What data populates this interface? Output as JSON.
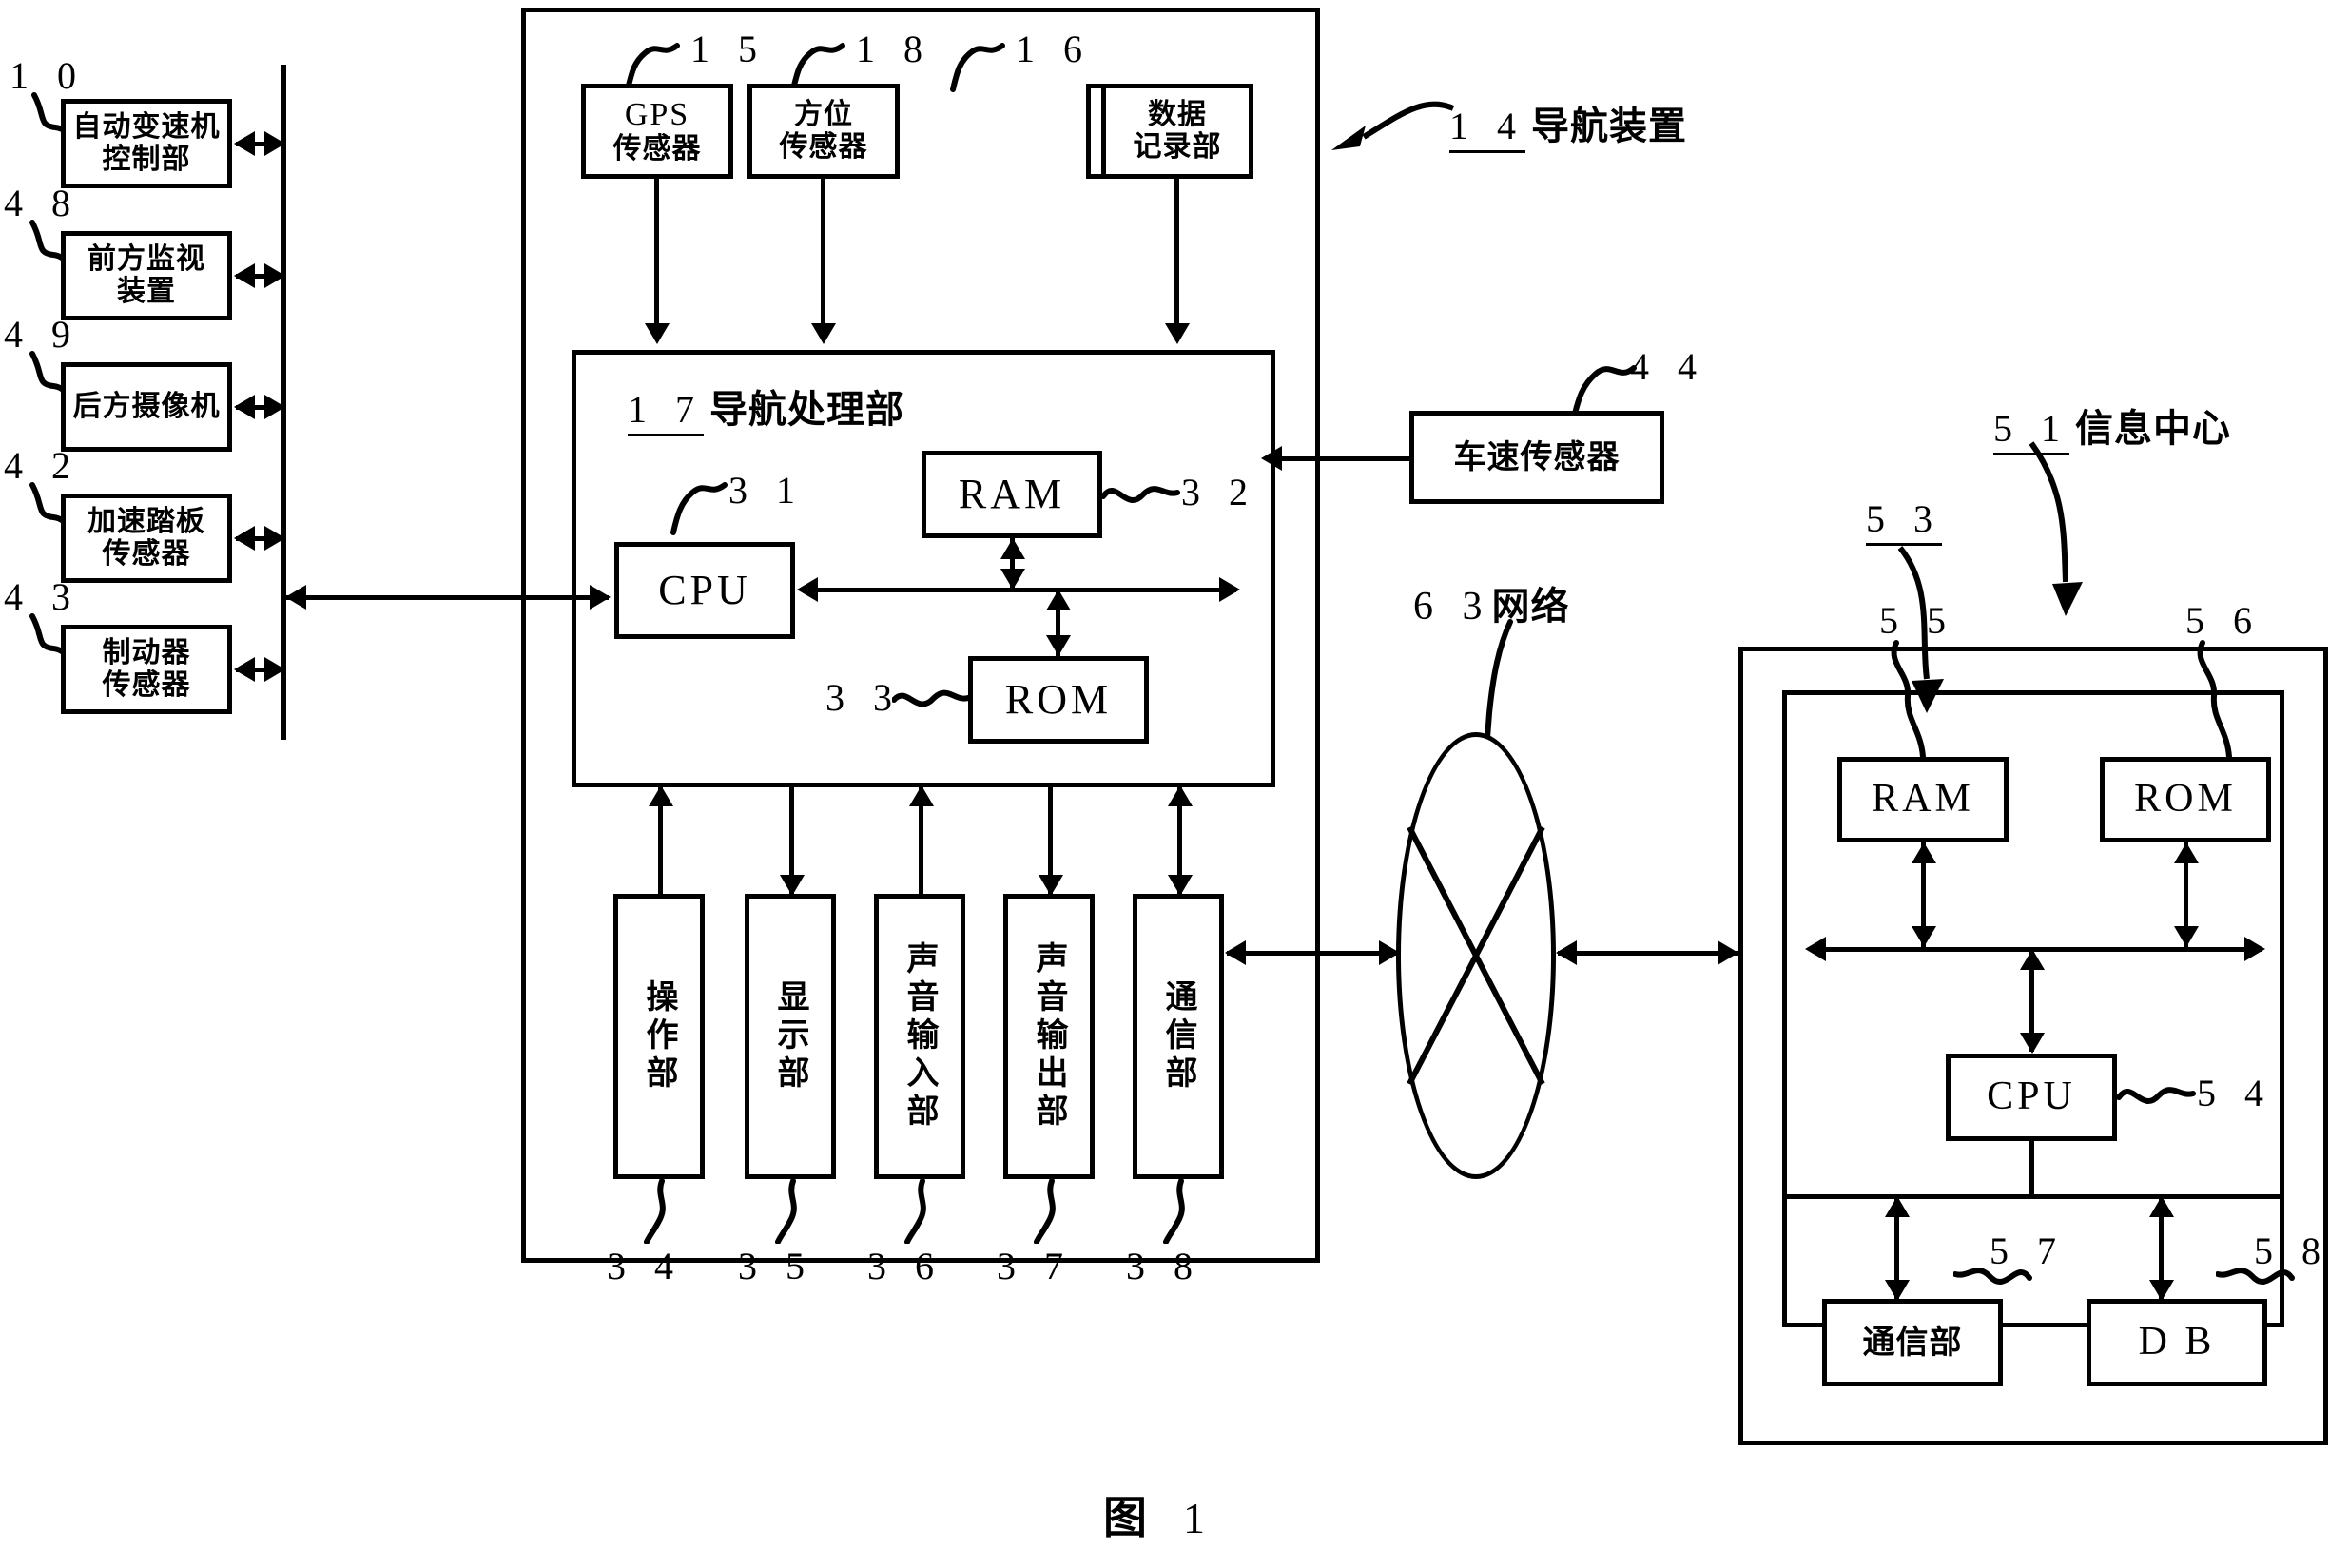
{
  "figure": {
    "caption_label": "图",
    "caption_number": "1"
  },
  "vehicle_units": [
    {
      "ref": "1 0",
      "label_line1": "自动变速机",
      "label_line2": "控制部"
    },
    {
      "ref": "4 8",
      "label_line1": "前方监视",
      "label_line2": "装置"
    },
    {
      "ref": "4 9",
      "label_line1": "后方摄像机",
      "label_line2": ""
    },
    {
      "ref": "4 2",
      "label_line1": "加速踏板",
      "label_line2": "传感器"
    },
    {
      "ref": "4 3",
      "label_line1": "制动器",
      "label_line2": "传感器"
    }
  ],
  "navigation": {
    "ref": "1 4",
    "title": "导航装置",
    "sensors": [
      {
        "ref": "1 5",
        "line1": "GPS",
        "line2": "传感器"
      },
      {
        "ref": "1 8",
        "line1": "方位",
        "line2": "传感器"
      },
      {
        "ref": "1 6",
        "line1": "数据",
        "line2": "记录部"
      }
    ],
    "processor": {
      "ref": "1 7",
      "title": "导航处理部",
      "cpu": {
        "ref": "3 1",
        "label": "CPU"
      },
      "ram": {
        "ref": "3 2",
        "label": "RAM"
      },
      "rom": {
        "ref": "3 3",
        "label": "ROM"
      }
    },
    "io_units": [
      {
        "ref": "3 4",
        "label": "操作部"
      },
      {
        "ref": "3 5",
        "label": "显示部"
      },
      {
        "ref": "3 6",
        "label": "声音输入部"
      },
      {
        "ref": "3 7",
        "label": "声音输出部"
      },
      {
        "ref": "3 8",
        "label": "通信部"
      }
    ]
  },
  "speed_sensor": {
    "ref": "4 4",
    "label": "车速传感器"
  },
  "network": {
    "ref": "6 3",
    "label": "网络"
  },
  "info_center": {
    "ref": "5 1",
    "title": "信息中心",
    "inner_ref": "5 3",
    "ram": {
      "ref": "5 5",
      "label": "RAM"
    },
    "rom": {
      "ref": "5 6",
      "label": "ROM"
    },
    "cpu": {
      "ref": "5 4",
      "label": "CPU"
    },
    "comm": {
      "ref": "5 7",
      "label": "通信部"
    },
    "db": {
      "ref": "5 8",
      "label": "D B"
    }
  }
}
